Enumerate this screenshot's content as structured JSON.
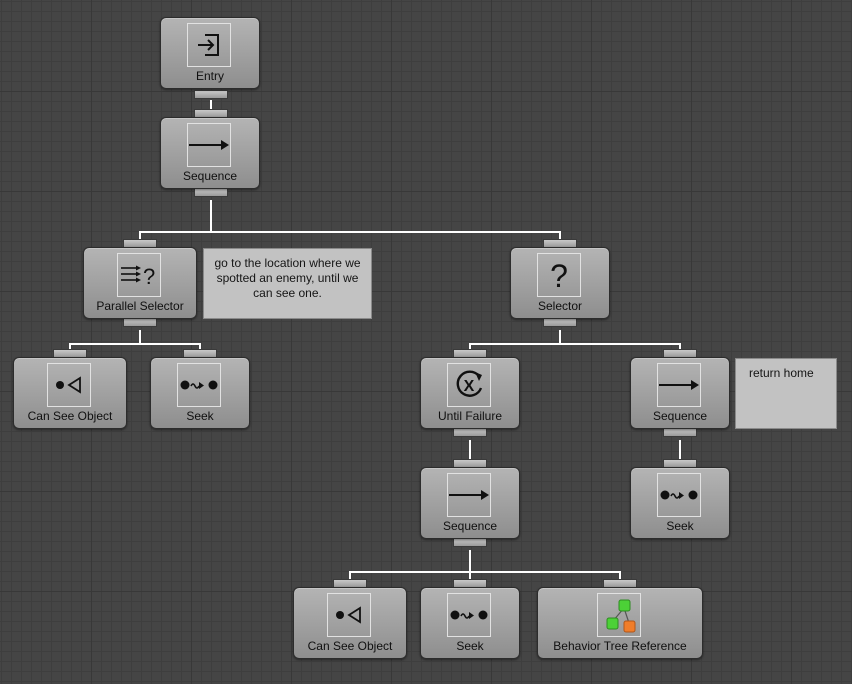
{
  "nodes": {
    "entry": {
      "label": "Entry",
      "icon": "entry-icon"
    },
    "root_sequence": {
      "label": "Sequence",
      "icon": "sequence-arrow-icon"
    },
    "parallel_selector": {
      "label": "Parallel Selector",
      "icon": "parallel-selector-icon"
    },
    "selector": {
      "label": "Selector",
      "icon": "selector-question-icon"
    },
    "can_see_object_1": {
      "label": "Can See Object",
      "icon": "eye-icon"
    },
    "seek_1": {
      "label": "Seek",
      "icon": "seek-icon"
    },
    "until_failure": {
      "label": "Until Failure",
      "icon": "until-failure-icon"
    },
    "return_sequence": {
      "label": "Sequence",
      "icon": "sequence-arrow-icon"
    },
    "inner_sequence": {
      "label": "Sequence",
      "icon": "sequence-arrow-icon"
    },
    "seek_return": {
      "label": "Seek",
      "icon": "seek-icon"
    },
    "can_see_object_2": {
      "label": "Can See Object",
      "icon": "eye-icon"
    },
    "seek_2": {
      "label": "Seek",
      "icon": "seek-icon"
    },
    "behavior_tree_reference": {
      "label": "Behavior Tree Reference",
      "icon": "behavior-tree-reference-icon"
    }
  },
  "comments": {
    "parallel_selector_comment": "go to the location where we spotted an enemy, until we can see one.",
    "return_home_comment": "return home"
  },
  "colors": {
    "canvas": "#454545",
    "node": "#a0a0a0",
    "connection": "#ffffff",
    "comment": "#c2c2c2",
    "reference_green": "#4cd137",
    "reference_orange": "#f07d2a"
  }
}
